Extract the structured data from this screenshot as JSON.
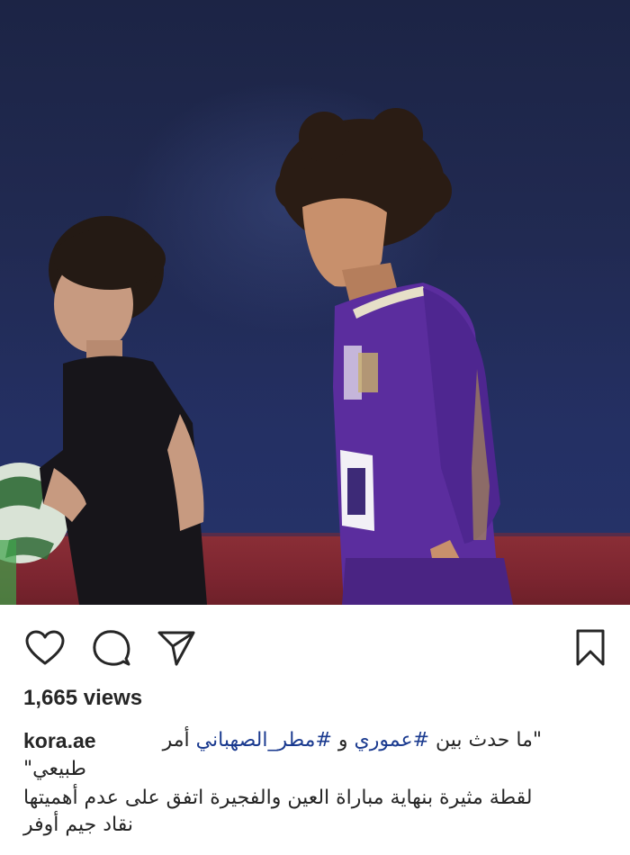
{
  "post": {
    "media": {
      "description_icon": "photo-media"
    },
    "actions": {
      "like_icon": "heart-icon",
      "comment_icon": "comment-icon",
      "share_icon": "send-icon",
      "save_icon": "bookmark-icon"
    },
    "views": "1,665 views",
    "caption": {
      "username": "kora.ae",
      "quote_open": "\"ما حدث بين",
      "hashtag1": "#عموري",
      "conj": "و",
      "hashtag2": "#مطر_الصهباني",
      "word_amr": "أمر",
      "line2": "طبيعي\"",
      "line3": "لقطة مثيرة بنهاية مباراة العين والفجيرة اتفق على عدم أهميتها",
      "line4": "نقاد جيم أوفر"
    },
    "colors": {
      "text": "#262626",
      "hashtag": "#1a3a8f",
      "jersey": "#5b2d9e"
    }
  }
}
